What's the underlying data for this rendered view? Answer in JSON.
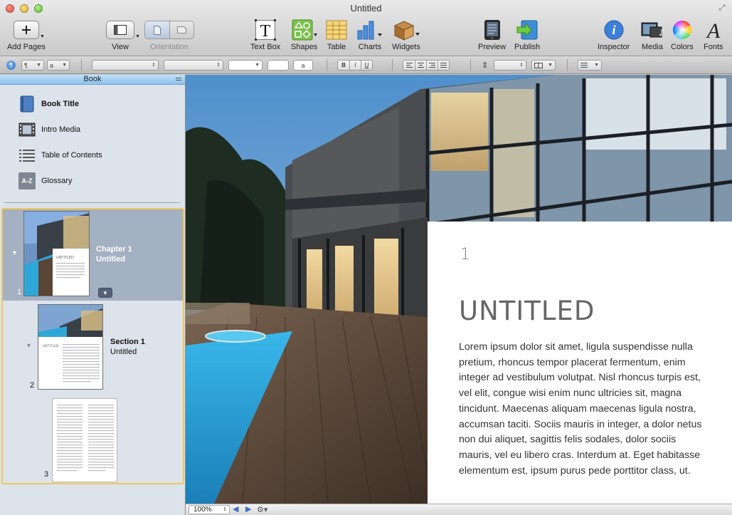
{
  "window": {
    "title": "Untitled"
  },
  "toolbar": {
    "add_pages": "Add Pages",
    "view": "View",
    "orientation": "Orientation",
    "text_box": "Text Box",
    "shapes": "Shapes",
    "table": "Table",
    "charts": "Charts",
    "widgets": "Widgets",
    "preview": "Preview",
    "publish": "Publish",
    "inspector": "Inspector",
    "media": "Media",
    "colors": "Colors",
    "fonts": "Fonts"
  },
  "formatbar": {
    "para_style": "¶",
    "char_style": "a",
    "text_color_glyph": "a",
    "bold": "B",
    "italic": "I",
    "underline": "U"
  },
  "sidebar": {
    "header": "Book",
    "items": [
      {
        "label": "Book Title",
        "icon": "book-icon"
      },
      {
        "label": "Intro Media",
        "icon": "film-icon"
      },
      {
        "label": "Table of Contents",
        "icon": "list-icon"
      },
      {
        "label": "Glossary",
        "icon": "glossary-az-icon",
        "glyph": "A-Z"
      }
    ],
    "pages": [
      {
        "number": "1",
        "label_line1": "Chapter 1",
        "label_line2": "Untitled",
        "thumb_title": "UNTITLED"
      },
      {
        "number": "2",
        "label_line1": "Section 1",
        "label_line2": "Untitled",
        "thumb_title": "UNTITLED"
      },
      {
        "number": "3"
      }
    ]
  },
  "page": {
    "chapter_number": "1",
    "title": "UNTITLED",
    "body": "Lorem ipsum dolor sit amet, ligula suspendisse nulla pretium, rhoncus tempor placerat fermen­tum, enim integer ad vestibulum volutpat. Nisl rhoncus turpis est, vel elit, congue wisi enim nunc ultricies sit, magna tincidunt. Maecenas aliquam maecenas ligula nostra, accumsan taciti. Sociis mauris in integer, a dolor netus non dui aliquet, sagittis felis sodales, dolor sociis mauris, vel eu lib­ero cras. Interdum at. Eget habitasse elementum est, ipsum purus pede porttitor class, ut."
  },
  "statusbar": {
    "zoom": "100%"
  }
}
